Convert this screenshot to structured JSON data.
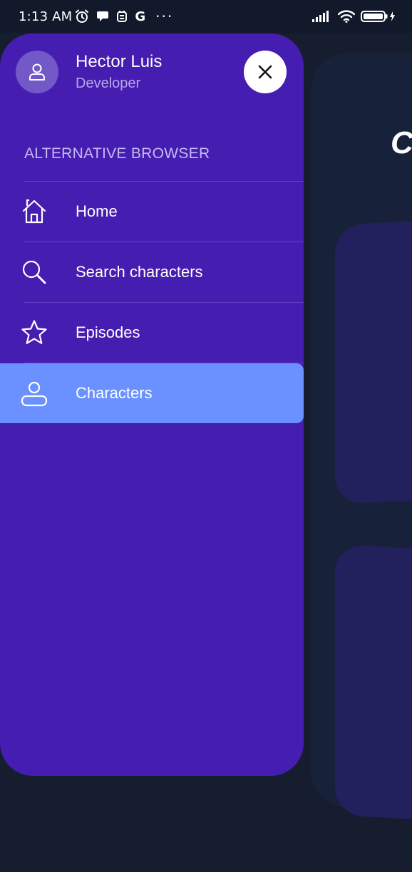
{
  "status_bar": {
    "time": "1:13 AM",
    "g_label": "G",
    "more": "···",
    "left_icons": [
      "alarm-icon",
      "chat-icon",
      "vpn-key-icon",
      "google-icon"
    ],
    "right_icons": [
      "signal-icon",
      "wifi-icon",
      "battery-charging-icon"
    ]
  },
  "background": {
    "title_fragment": "C"
  },
  "drawer": {
    "user": {
      "name": "Hector Luis",
      "role": "Developer",
      "avatar_icon": "person-icon"
    },
    "close_icon": "close-icon",
    "section_title": "ALTERNATIVE BROWSER",
    "menu": [
      {
        "label": "Home",
        "icon": "home-icon",
        "active": false
      },
      {
        "label": "Search characters",
        "icon": "search-icon",
        "active": false
      },
      {
        "label": "Episodes",
        "icon": "star-icon",
        "active": false
      },
      {
        "label": "Characters",
        "icon": "person-icon",
        "active": true
      }
    ]
  },
  "colors": {
    "drawer_bg": "#461db1",
    "active_item_bg": "#6a91ff",
    "page_bg": "#161d2e",
    "card_bg": "#23205e",
    "section_title": "#c6baf2",
    "role_text": "#b6a8ea"
  }
}
